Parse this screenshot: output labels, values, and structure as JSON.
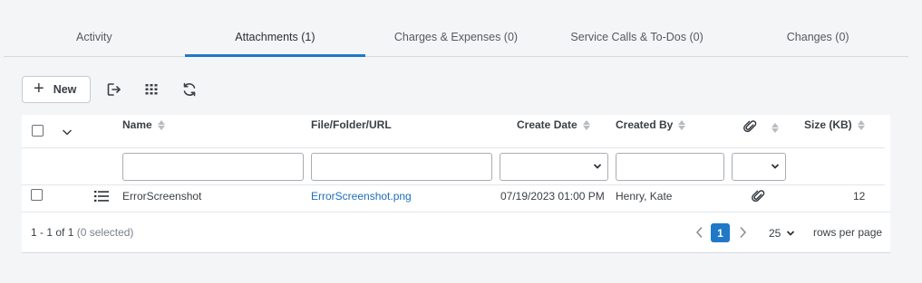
{
  "tabs": [
    {
      "label": "Activity"
    },
    {
      "label": "Attachments (1)"
    },
    {
      "label": "Charges & Expenses (0)"
    },
    {
      "label": "Service Calls & To-Dos (0)"
    },
    {
      "label": "Changes (0)"
    }
  ],
  "active_tab": "Attachments (1)",
  "toolbar": {
    "new_label": "New",
    "icons": [
      "export-icon",
      "column-chooser-icon",
      "refresh-icon"
    ]
  },
  "grid": {
    "columns": [
      "Name",
      "File/Folder/URL",
      "Create Date",
      "Created By",
      "Size (KB)"
    ],
    "attachment_column_icon": "paperclip-icon",
    "rows": [
      {
        "name": "ErrorScreenshot",
        "file": "ErrorScreenshot.png",
        "create_date": "07/19/2023 01:00 PM",
        "created_by": "Henry, Kate",
        "has_attachment_icon": "paperclip-icon",
        "size_kb": "12"
      }
    ]
  },
  "footer": {
    "range": "1 - 1 of 1",
    "selected": "(0 selected)",
    "current_page": "1",
    "rows_per_page": "25",
    "rows_per_page_label": "rows per page"
  },
  "colors": {
    "accent": "#1f78c8",
    "link": "#1f6fb5",
    "background": "#f4f5f7"
  }
}
